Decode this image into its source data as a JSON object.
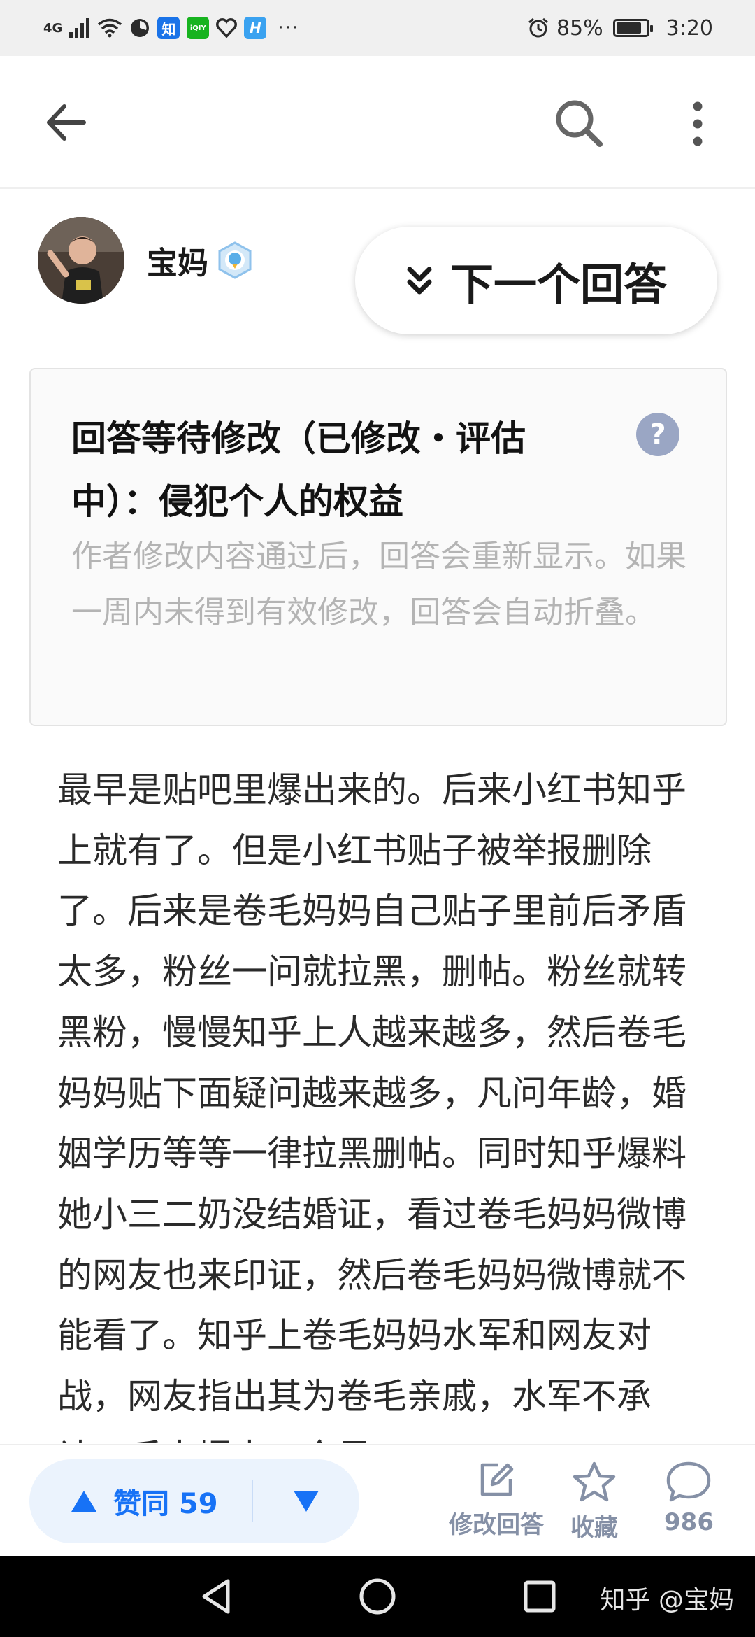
{
  "status_bar": {
    "network": "4G",
    "apps": [
      "知",
      "iQIY",
      "H"
    ],
    "more": "···",
    "battery": "85%",
    "battery_level": 0.85,
    "time": "3:20"
  },
  "author": {
    "name": "宝妈"
  },
  "next_answer": {
    "label": "下一个回答"
  },
  "notice": {
    "title": "回答等待修改（已修改・评估中）：侵犯个人的权益",
    "help": "?",
    "description": "作者修改内容通过后，回答会重新显示。如果一周内未得到有效修改，回答会自动折叠。"
  },
  "answer": {
    "text": "最早是贴吧里爆出来的。后来小红书知乎上就有了。但是小红书贴子被举报删除了。后来是卷毛妈妈自己贴子里前后矛盾太多，粉丝一问就拉黑，删帖。粉丝就转黑粉，慢慢知乎上人越来越多，然后卷毛妈妈贴下面疑问越来越多，凡问年龄，婚姻学历等等一律拉黑删帖。同时知乎爆料她小三二奶没结婚证，看过卷毛妈妈微博的网友也来印证，然后卷毛妈妈微博就不能看了。知乎上卷毛妈妈水军和网友对战，网友指出其为卷毛亲戚，水军不承认，后来爆出，全是"
  },
  "actions": {
    "upvote_label": "赞同 59",
    "edit_label": "修改回答",
    "collect_label": "收藏",
    "comment_count": "986"
  },
  "nav": {
    "watermark": "知乎 @宝妈"
  }
}
